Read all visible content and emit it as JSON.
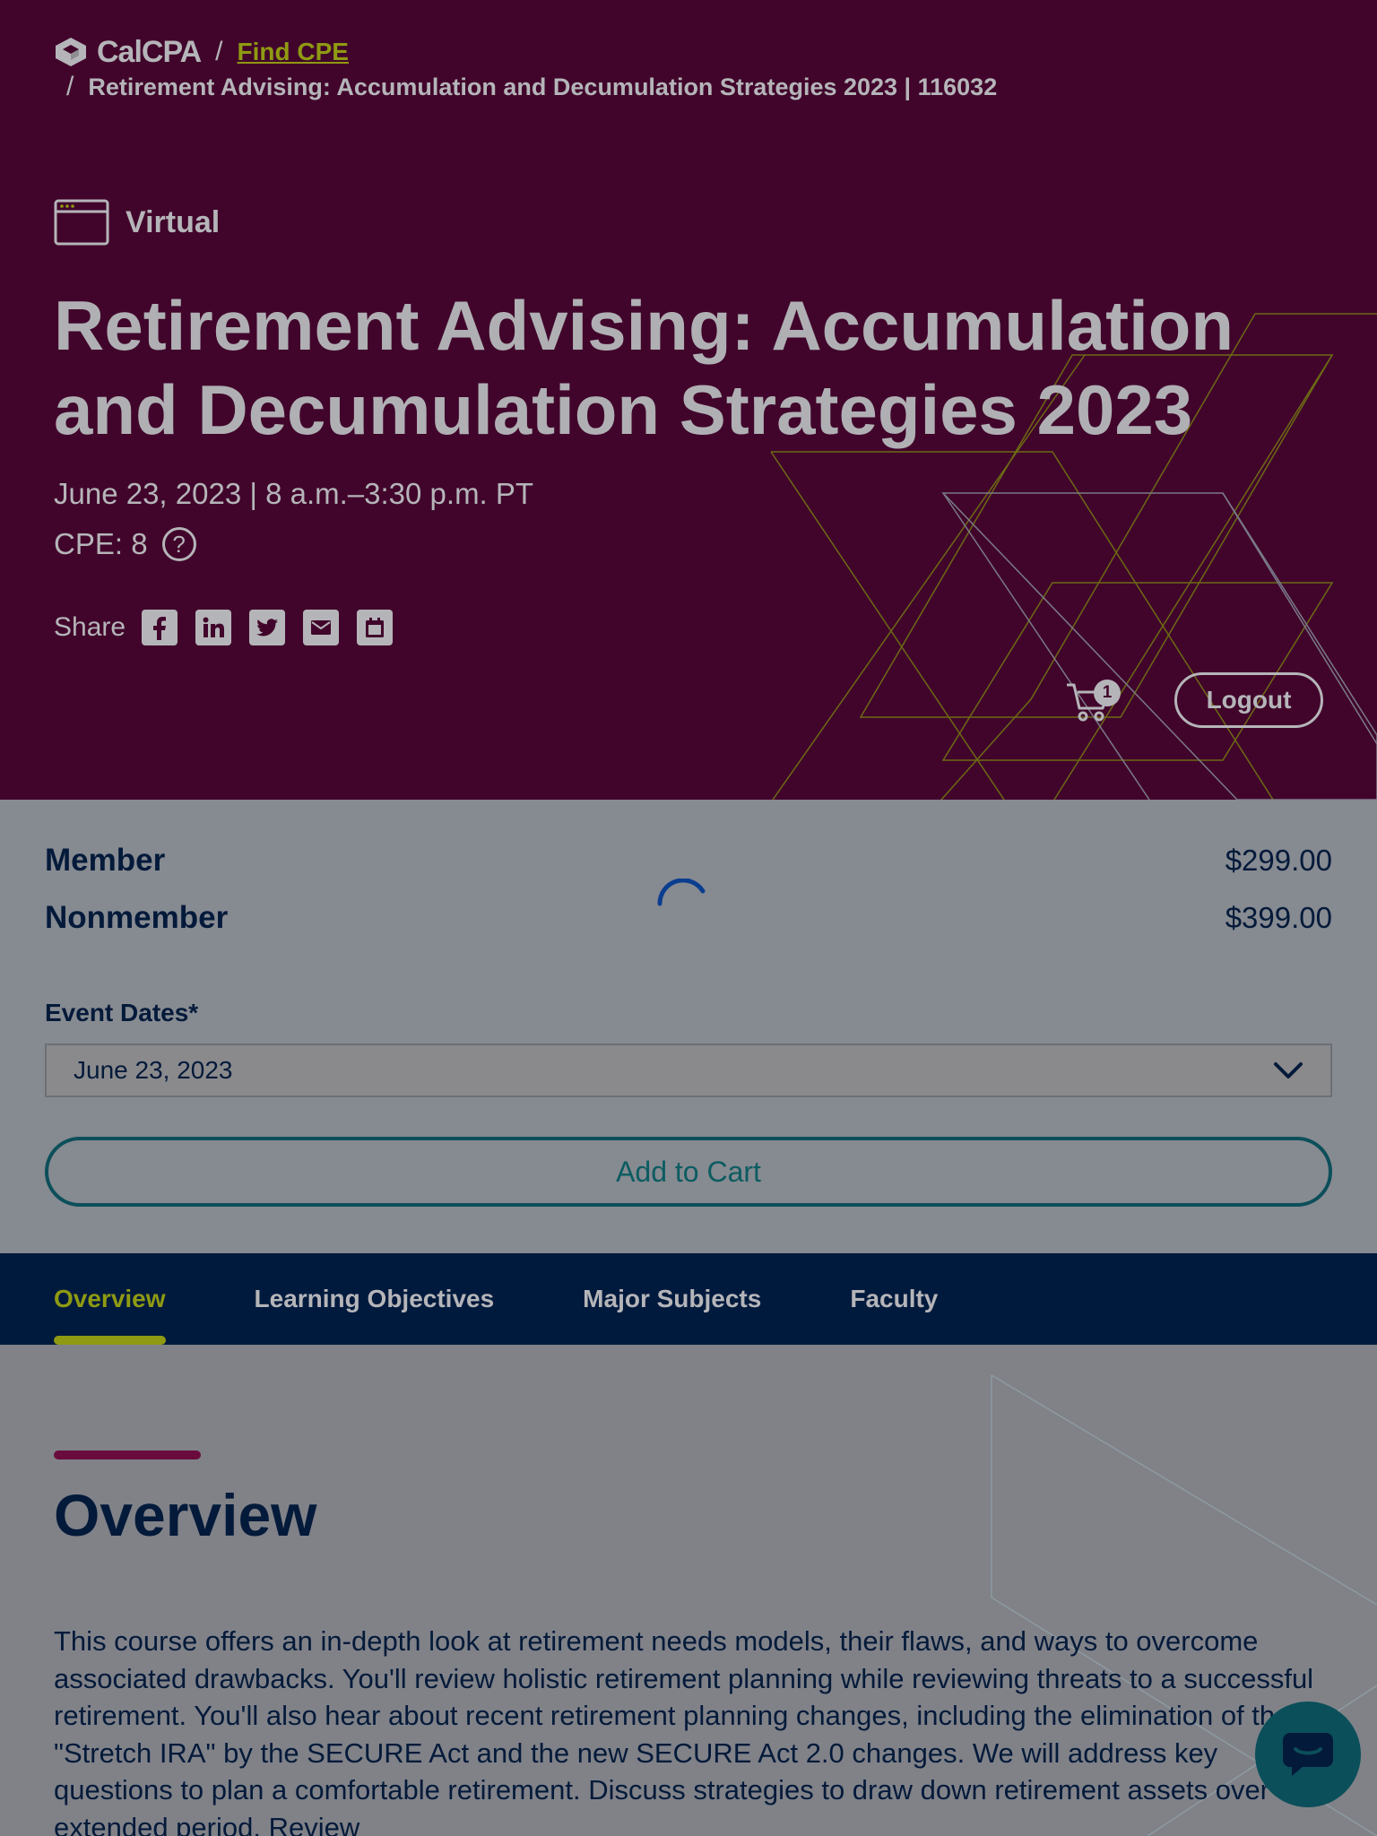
{
  "breadcrumb": {
    "logo_text": "CalCPA",
    "separator": "/",
    "link": "Find CPE",
    "current": "Retirement Advising: Accumulation and Decumulation Strategies 2023 | 116032"
  },
  "event": {
    "type": "Virtual",
    "title": "Retirement Advising: Accumulation and Decumulation Strategies 2023",
    "date_time": "June 23, 2023 | 8 a.m.–3:30 p.m. PT",
    "cpe": "CPE: 8",
    "help_symbol": "?"
  },
  "share": {
    "label": "Share",
    "icons": [
      "facebook-icon",
      "linkedin-icon",
      "twitter-icon",
      "email-icon",
      "calendar-icon"
    ]
  },
  "header_actions": {
    "cart_count": "1",
    "logout_label": "Logout"
  },
  "pricing": {
    "rows": [
      {
        "label": "Member",
        "price": "$299.00"
      },
      {
        "label": "Nonmember",
        "price": "$399.00"
      }
    ],
    "event_dates_label": "Event Dates*",
    "event_dates_value": "June 23, 2023",
    "add_to_cart": "Add to Cart"
  },
  "tabs": [
    {
      "label": "Overview",
      "active": true
    },
    {
      "label": "Learning Objectives",
      "active": false
    },
    {
      "label": "Major Subjects",
      "active": false
    },
    {
      "label": "Faculty",
      "active": false
    }
  ],
  "overview": {
    "heading": "Overview",
    "body": "This course offers an in-depth look at retirement needs models, their flaws, and ways to overcome associated drawbacks. You'll review holistic retirement planning while reviewing threats to a successful retirement. You'll also hear about recent retirement planning changes, including the elimination of the \"Stretch IRA\" by the SECURE Act and the new SECURE Act 2.0 changes. We will address key questions to plan a comfortable retirement. Discuss strategies to draw down retirement assets over an extended period. Review"
  },
  "colors": {
    "hero_bg": "#41052b",
    "accent_olive": "#8f9a12",
    "navy": "#001a3d",
    "teal": "#0b4f5a",
    "text_light": "#b5b5b9"
  }
}
